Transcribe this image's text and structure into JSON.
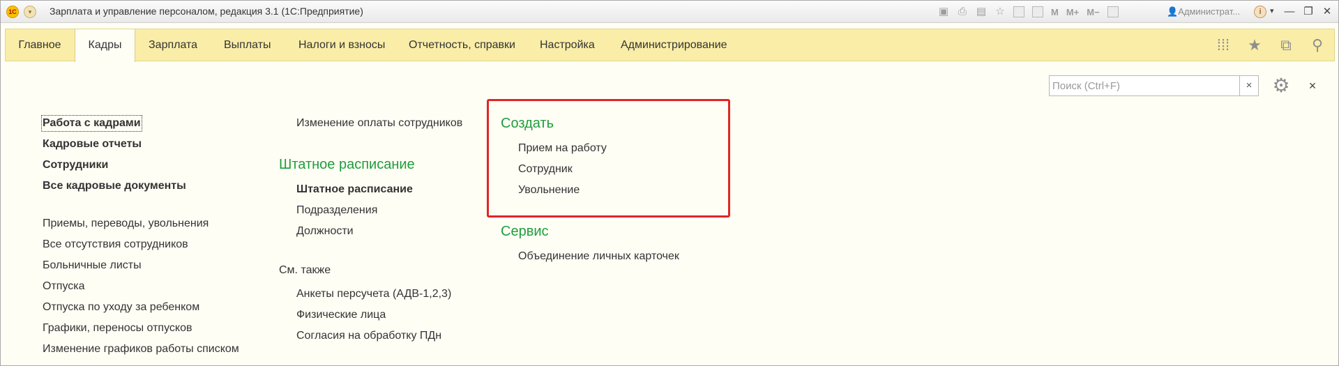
{
  "window": {
    "title": "Зарплата и управление персоналом, редакция 3.1  (1С:Предприятие)",
    "logo": "1С",
    "user": "Администрат...",
    "toolbar_icons": [
      "save-icon",
      "print-icon",
      "preview-icon",
      "favorite-icon",
      "calendar-icon",
      "calculator-icon",
      "memory-icon",
      "panels-icon"
    ],
    "memory": {
      "m": "M",
      "m_plus": "M+",
      "m_minus": "M−"
    },
    "info": "i"
  },
  "sections": {
    "tabs": [
      {
        "label": "Главное"
      },
      {
        "label": "Кадры",
        "active": true
      },
      {
        "label": "Зарплата"
      },
      {
        "label": "Выплаты"
      },
      {
        "label": "Налоги и взносы"
      },
      {
        "label": "Отчетность, справки"
      },
      {
        "label": "Настройка"
      },
      {
        "label": "Администрирование"
      }
    ]
  },
  "search": {
    "placeholder": "Поиск (Ctrl+F)",
    "clear": "×"
  },
  "close": "×",
  "col1": {
    "main_links": [
      "Работа с кадрами",
      "Кадровые отчеты",
      "Сотрудники",
      "Все кадровые документы"
    ],
    "links": [
      "Приемы, переводы, увольнения",
      "Все отсутствия сотрудников",
      "Больничные листы",
      "Отпуска",
      "Отпуска по уходу за ребенком",
      "Графики, переносы отпусков",
      "Изменение графиков работы списком"
    ]
  },
  "col2": {
    "top_link": "Изменение оплаты сотрудников",
    "staffing_title": "Штатное расписание",
    "staffing_links": [
      "Штатное расписание",
      "Подразделения",
      "Должности"
    ],
    "see_also_title": "См. также",
    "see_also_links": [
      "Анкеты персучета (АДВ-1,2,3)",
      "Физические лица",
      "Согласия на обработку ПДн"
    ]
  },
  "col3": {
    "create_title": "Создать",
    "create_links": [
      "Прием на работу",
      "Сотрудник",
      "Увольнение"
    ],
    "service_title": "Сервис",
    "service_links": [
      "Объединение личных карточек"
    ]
  },
  "colors": {
    "group_title": "#1e9d3b",
    "section_panel": "#faeda7",
    "highlight": "#e02626"
  }
}
